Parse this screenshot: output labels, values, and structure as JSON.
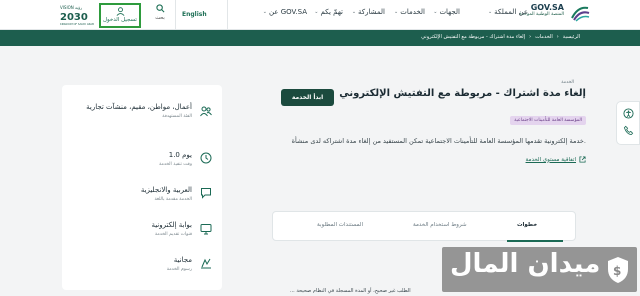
{
  "header": {
    "logo_name": "GOV.SA",
    "logo_subtitle": "المنصة الوطنية الموحدة",
    "nav": [
      {
        "label": "عن المملكة",
        "name": "nav-about-kingdom"
      },
      {
        "label": "الجهات",
        "name": "nav-entities"
      },
      {
        "label": "الخدمات",
        "name": "nav-services"
      },
      {
        "label": "المشاركة",
        "name": "nav-participation"
      },
      {
        "label": "تهمّ يكم",
        "name": "nav-interest"
      },
      {
        "label": "عن GOV.SA",
        "name": "nav-about-gov"
      }
    ],
    "language": "English",
    "search_label": "بحث",
    "login_label": "تسجيل الدخول",
    "vision_text": "VISION 2030"
  },
  "breadcrumb": [
    "الرئيسية",
    "الخدمات",
    "إلغاء مدة اشتراك - مربوطة مع التفتيش الإلكتروني"
  ],
  "service": {
    "kind": "الخدمة",
    "title": "إلغاء مدة اشتراك - مربوطة مع التفتيش الإلكتروني",
    "start_button": "ابدأ الخدمة",
    "tag": "المؤسسة العامة للتأمينات الاجتماعية",
    "description": "خدمة إلكترونية تقدمها المؤسسة العامة للتأمينات الاجتماعية تمكن المستفيد من إلغاء مدة اشتراكه لدى منشأة.",
    "doc_link": "اتفاقية مستوى الخدمة"
  },
  "info": [
    {
      "value": "أعمال، مواطن، مقيم، منشآت تجارية",
      "label": "الفئة المستهدفة",
      "icon": "users-icon"
    },
    {
      "value": "1.0 يوم",
      "label": "وقت تنفيذ الخدمة",
      "icon": "clock-icon"
    },
    {
      "value": "العربية والانجليزية",
      "label": "الخدمة مقدمة باللغة",
      "icon": "chat-icon"
    },
    {
      "value": "بوابة إلكترونية",
      "label": "قنوات تقديم الخدمة",
      "icon": "monitor-icon"
    },
    {
      "value": "مجانية",
      "label": "رسوم الخدمة",
      "icon": "fee-icon"
    }
  ],
  "tabs": [
    {
      "label": "خطوات",
      "active": true
    },
    {
      "label": "شروط استخدام الخدمة",
      "active": false
    },
    {
      "label": "المستندات المطلوبة",
      "active": false
    }
  ],
  "body_excerpt": "... الطلب غير صحيح، أو المدة المسجلة في النظام صحيحة",
  "watermark": "ميدان المال",
  "colors": {
    "brand_green": "#1d5e4e",
    "button_dark": "#1b4a3e",
    "tag_bg": "#e4d4ee",
    "login_border": "#2e9b3d"
  }
}
